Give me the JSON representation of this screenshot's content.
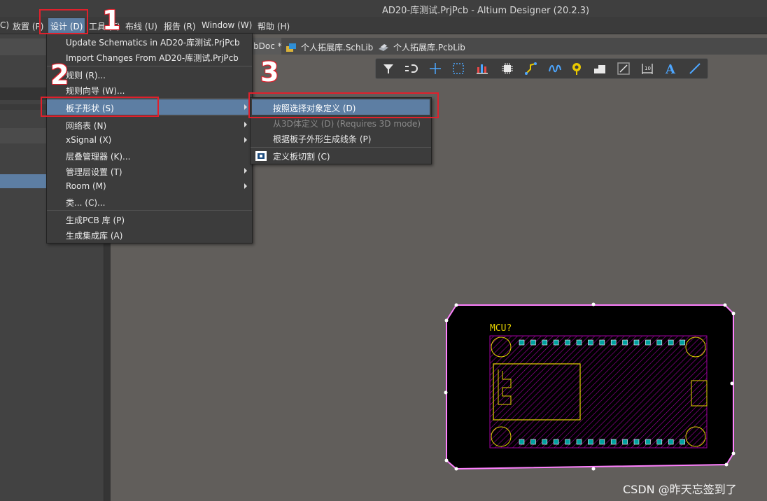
{
  "window": {
    "title": "AD20-库测试.PrjPcb - Altium Designer (20.2.3)"
  },
  "menubar": {
    "items": [
      "放置 (P)",
      "设计 (D)",
      "工具 (T)",
      "布线 (U)",
      "报告 (R)",
      "Window (W)",
      "帮助 (H)"
    ],
    "partial_left": "C)"
  },
  "tabs": [
    {
      "label": "bDoc *",
      "icon": "pcb-doc-icon"
    },
    {
      "label": "个人拓展库.SchLib",
      "icon": "schlib-icon"
    },
    {
      "label": "个人拓展库.PcbLib",
      "icon": "pcblib-icon"
    }
  ],
  "toolbar": {
    "icons": [
      "filter-icon",
      "snap-icon",
      "crosshair-icon",
      "select-rect-icon",
      "align-icon",
      "component-icon",
      "route-icon",
      "interactive-route-icon",
      "via-icon",
      "fill-icon",
      "region-icon",
      "dimension-icon",
      "text-icon",
      "line-icon"
    ]
  },
  "design_menu": {
    "items": [
      "Update Schematics in AD20-库测试.PrjPcb",
      "Import Changes From AD20-库测试.PrjPcb",
      "规则 (R)...",
      "规则向导 (W)...",
      "板子形状 (S)",
      "网络表 (N)",
      "xSignal (X)",
      "层叠管理器 (K)...",
      "管理层设置 (T)",
      "Room (M)",
      "类... (C)...",
      "生成PCB 库 (P)",
      "生成集成库 (A)"
    ]
  },
  "board_shape_submenu": {
    "items": [
      "按照选择对象定义 (D)",
      "从3D体定义 (D) (Requires 3D mode)",
      "根据板子外形生成线条 (P)",
      "定义板切割 (C)"
    ]
  },
  "steps": [
    "1",
    "2",
    "3"
  ],
  "pcb": {
    "designator": "MCU?",
    "colors": {
      "board": "#000000",
      "outline": "#ff80ff",
      "silk": "#e6d200",
      "pad": "#00a0a0",
      "region": "#a000a0"
    }
  },
  "watermark": "CSDN @昨天忘签到了"
}
